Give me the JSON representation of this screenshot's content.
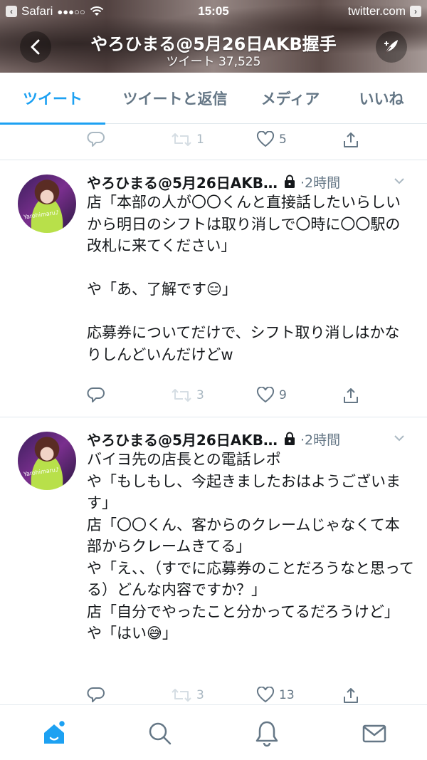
{
  "status_bar": {
    "back_app": "Safari",
    "signal": "●●●○○",
    "time": "15:05",
    "url": "twitter.com"
  },
  "header": {
    "title": "やろひまる@5月26日AKB握手",
    "subtitle": "ツイート 37,525"
  },
  "tabs": [
    {
      "label": "ツイート",
      "active": true
    },
    {
      "label": "ツイートと返信",
      "active": false
    },
    {
      "label": "メディア",
      "active": false
    },
    {
      "label": "いいね",
      "active": false
    }
  ],
  "stub_tweet": {
    "retweets": "1",
    "likes": "5"
  },
  "tweets": [
    {
      "name": "やろひまる@5月26日AKB…",
      "time": "·2時間",
      "text": "店「本部の人が〇〇くんと直接話したいらしいから明日のシフトは取り消しで〇時に〇〇駅の改札に来てください」\n\nや「あ、了解です😑」\n\n応募券についてだけで、シフト取り消しはかなりしんどいんだけどw",
      "retweets": "3",
      "likes": "9",
      "avatar_text": "Yarohimaru♪"
    },
    {
      "name": "やろひまる@5月26日AKB…",
      "time": "·2時間",
      "text": "バイヨ先の店長との電話レポ\nや「もしもし、今起きましたおはようございます」\n店「〇〇くん、客からのクレームじゃなくて本部からクレームきてる」\nや「え、、（すでに応募券のことだろうなと思ってる）どんな内容ですか？」\n店「自分でやったこと分かってるだろうけど」\nや「はい😅」",
      "retweets": "3",
      "likes": "13",
      "avatar_text": "Yarohimaru♪"
    }
  ],
  "bottom_nav": [
    {
      "icon": "home-icon",
      "active": true
    },
    {
      "icon": "search-icon",
      "active": false
    },
    {
      "icon": "notifications-icon",
      "active": false
    },
    {
      "icon": "messages-icon",
      "active": false
    }
  ],
  "colors": {
    "accent": "#1da1f2",
    "muted": "#657786",
    "icon": "#aab8c2",
    "divider": "#e1e8ed"
  }
}
